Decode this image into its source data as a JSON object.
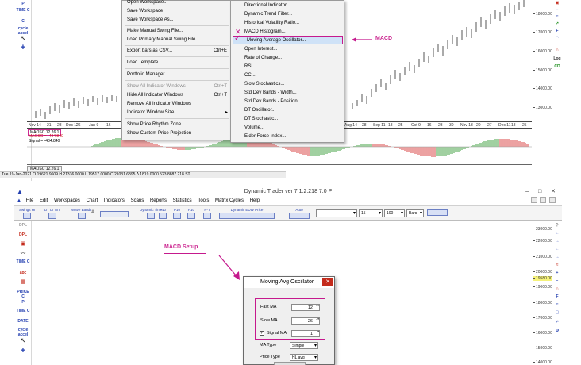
{
  "top": {
    "left_toolbar": [
      {
        "label": "P",
        "icon": "text-tool"
      },
      {
        "label": "TIME C",
        "icon": "time-tool"
      },
      {
        "label": "C",
        "icon": "c-tool"
      },
      {
        "label": "cycle accel",
        "icon": "cycle-accel-tool"
      },
      {
        "label": "↖",
        "icon": "pointer-icon"
      },
      {
        "label": "+",
        "icon": "crosshair-icon"
      }
    ],
    "y_ticks": [
      "18000.000",
      "17000.000",
      "16000.000",
      "15000.000",
      "14000.000",
      "13000.000"
    ],
    "date_labels_left": [
      "Nov 14",
      "21",
      "28",
      "Dec 12",
      "26",
      "Jan 9",
      "16"
    ],
    "date_labels_right": [
      "Aug 14",
      "28",
      "Sep 11",
      "18",
      "25",
      "Oct 9",
      "16",
      "23",
      "30",
      "Nov 13",
      "20",
      "27",
      "Dec 11",
      "18",
      "25"
    ],
    "file_menu": {
      "items": [
        {
          "label": "Open Workspace...",
          "shortcut": "",
          "disabled": false
        },
        {
          "label": "Save Workspace",
          "shortcut": "",
          "disabled": false
        },
        {
          "label": "Save Workspace As...",
          "shortcut": "",
          "disabled": false
        },
        {
          "label": "Make Manual Swing File...",
          "shortcut": "",
          "disabled": false
        },
        {
          "label": "Load Primary Manual Swing File...",
          "shortcut": "",
          "disabled": false
        },
        {
          "label": "Export bars as CSV...",
          "shortcut": "Ctrl+E",
          "disabled": false
        },
        {
          "label": "Load Template...",
          "shortcut": "",
          "disabled": false
        },
        {
          "label": "Portfolio Manager...",
          "shortcut": "",
          "disabled": false
        },
        {
          "label": "Show All Indicator Windows",
          "shortcut": "Ctrl+T",
          "disabled": true
        },
        {
          "label": "Hide All Indicator Windows",
          "shortcut": "Ctrl+T",
          "disabled": false
        },
        {
          "label": "Remove All Indicator Windows",
          "shortcut": "",
          "disabled": false
        },
        {
          "label": "Indicator Window Size",
          "shortcut": "",
          "disabled": false
        },
        {
          "label": "Show Price Rhythm Zone",
          "shortcut": "",
          "disabled": false
        },
        {
          "label": "Show Custom Price Projection",
          "shortcut": "",
          "disabled": false
        }
      ]
    },
    "indicator_menu": {
      "items": [
        "Directional Indicator...",
        "Dynamic Trend Filter...",
        "Historical Volatility Ratio...",
        "MACD Histogram...",
        "Moving Average Oscillator...",
        "Open Interest...",
        "Rate of Change...",
        "RSI...",
        "CCI...",
        "Slow Stochastics...",
        "Std Dev Bands - Width...",
        "Std Dev Bands - Position...",
        "DT Oscillator...",
        "DT Stochastic...",
        "Volume...",
        "Elder Force Index..."
      ]
    },
    "annotation_macd": "MACD",
    "osc_tag": "MAOSC 12.26.1",
    "osc_value": "MAOSC = -12.26.1",
    "osc_maosc": "MAOSC = -484.840",
    "osc_signal": "Signal = -484.840",
    "osc_tab": "MAOSC 12.26.1",
    "status_bar": "Tue 19-Jan-2021  O 19621.9609 H 21336.0000  L 19517.0000  C 21031.6895 Δ 1819.0000 523.8887   218          ST"
  },
  "bottom": {
    "window_title": "Dynamic Trader ver 7.1.2.218 7.0 P",
    "window_buttons": [
      "–",
      "□",
      "✕"
    ],
    "menu": [
      "File",
      "Edit",
      "Workspaces",
      "Chart",
      "Indicators",
      "Scans",
      "Reports",
      "Statistics",
      "Tools",
      "Matrix Cycles",
      "Help"
    ],
    "toolbar": {
      "tools": [
        "Swings HI",
        "DT LT MT",
        "Wave Bands",
        "A",
        "Dynamic Time",
        "P10",
        "P10",
        "P10",
        "P-T",
        "Dynamic EDW Price",
        "Auto"
      ],
      "dropdown_1": "",
      "dropdown_2": "15",
      "dropdown_3": "100",
      "dropdown_4": "Bars"
    },
    "left_toolbar": [
      "DPL",
      "DPL",
      "",
      "",
      "TIME C",
      "abc",
      "",
      "PRICE C",
      "P",
      "TIME C",
      "DATE",
      "cycle accel",
      "↖",
      "+"
    ],
    "y_ticks": [
      "23000.000",
      "22000.000",
      "21000.000",
      "20000.000",
      "19580.000",
      "19000.000",
      "18000.000",
      "17000.000",
      "16000.000",
      "15000.000",
      "14000.000"
    ],
    "price_highlight": "19580.000",
    "annotation_setup": "MACD Setup",
    "dialog": {
      "title": "Moving Avg Oscillator",
      "close": "✕",
      "fast_ma_label": "Fast MA",
      "fast_ma_value": "12",
      "slow_ma_label": "Slow MA",
      "slow_ma_value": "26",
      "signal_ma_checked": true,
      "signal_ma_label": "Signal MA",
      "signal_ma_value": "1",
      "ma_type_label": "MA Type",
      "ma_type_value": "Simple",
      "price_type_label": "Price Type",
      "price_type_value": "HL avg"
    }
  },
  "colors": {
    "accent_magenta": "#c5198d",
    "osc_red": "#d01515",
    "osc_green": "#138a13",
    "close_red": "#c42b1c",
    "price_highlight": "#f5f27a"
  }
}
